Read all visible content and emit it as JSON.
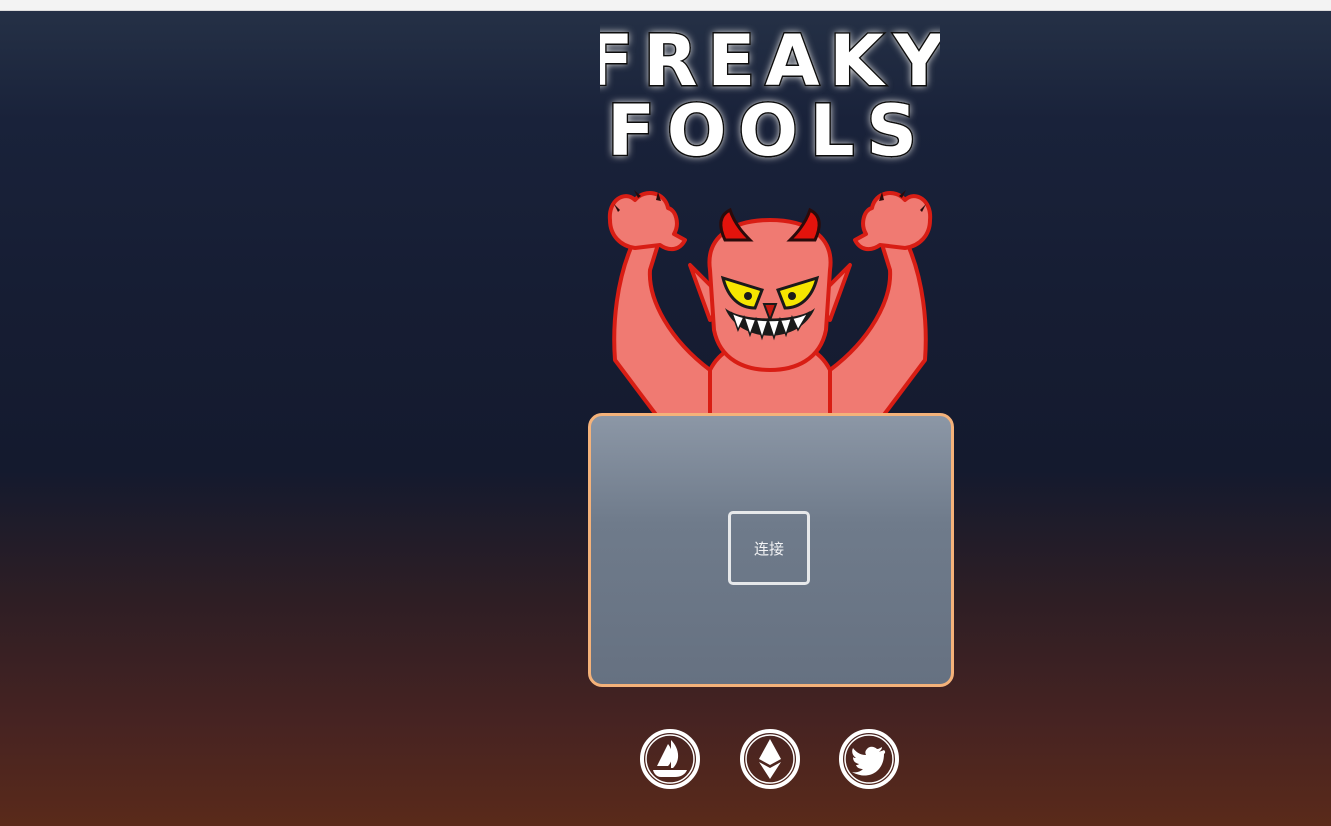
{
  "header": {
    "logo_line1": "FREAKY",
    "logo_line2": "FOOLS"
  },
  "mint_panel": {
    "connect_label": "连接"
  },
  "social": [
    {
      "icon": "opensea-icon"
    },
    {
      "icon": "ethereum-icon"
    },
    {
      "icon": "twitter-icon"
    }
  ],
  "colors": {
    "panel_border": "#f4b27a",
    "devil_skin": "#f07a72",
    "devil_outline": "#e0201a",
    "devil_eyes": "#f6e600"
  }
}
